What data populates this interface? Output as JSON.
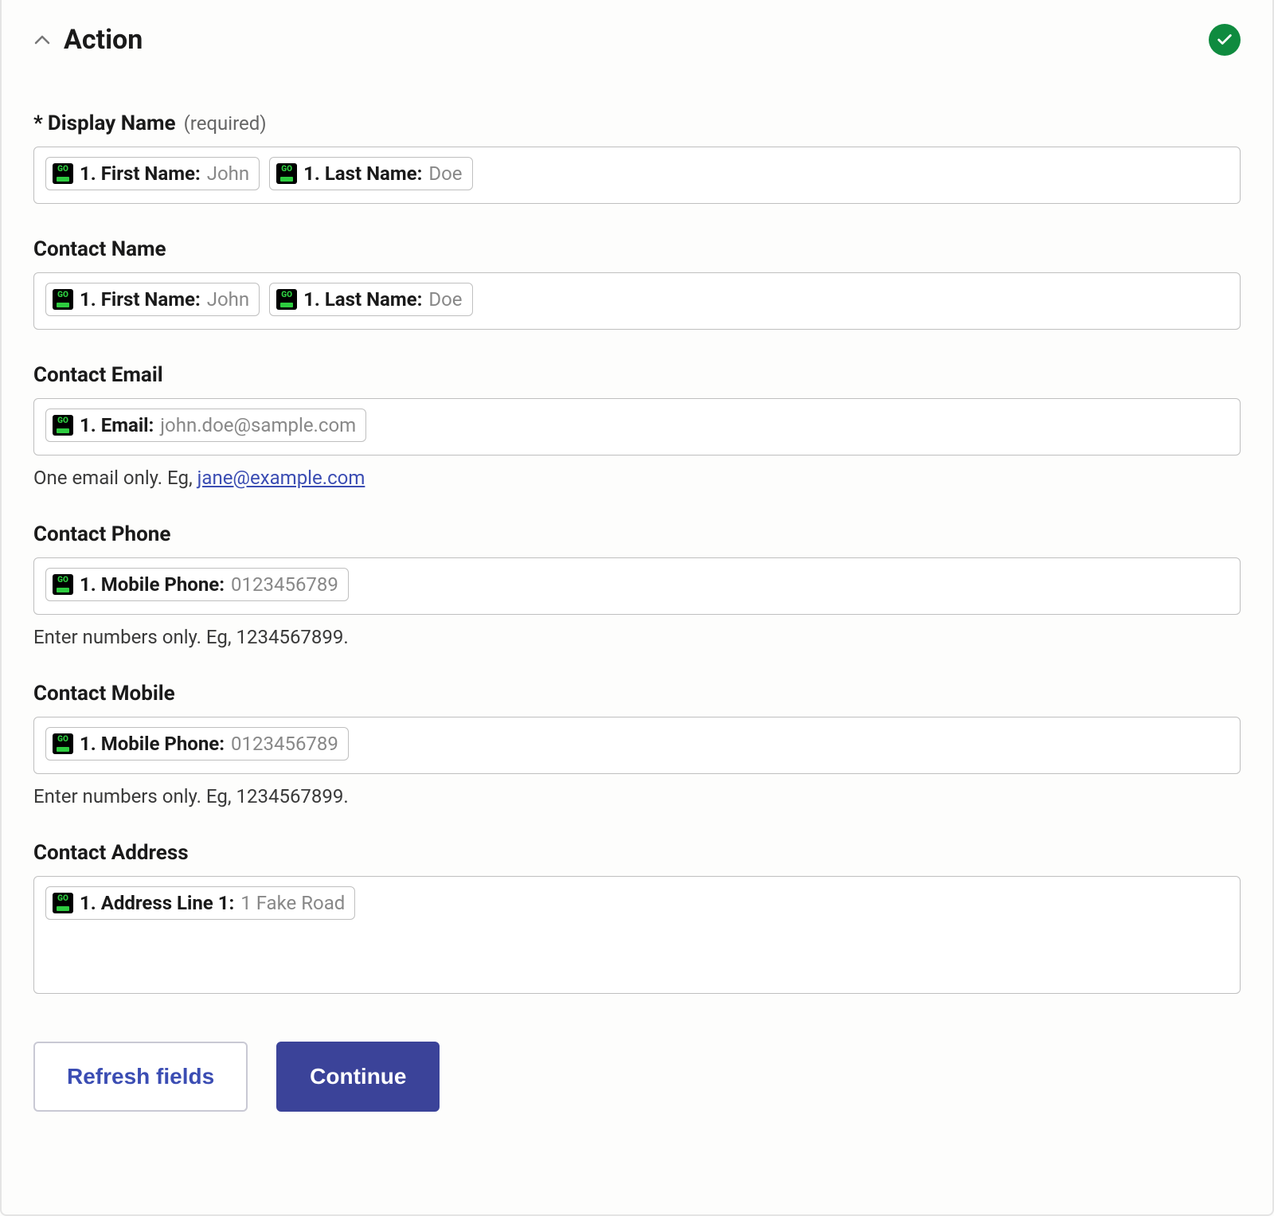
{
  "panel": {
    "title": "Action"
  },
  "fields": {
    "displayName": {
      "label": "Display Name",
      "asterisk": "*",
      "requiredText": "(required)",
      "pills": [
        {
          "label": "1. First Name:",
          "value": "John"
        },
        {
          "label": "1. Last Name:",
          "value": "Doe"
        }
      ]
    },
    "contactName": {
      "label": "Contact Name",
      "pills": [
        {
          "label": "1. First Name:",
          "value": "John"
        },
        {
          "label": "1. Last Name:",
          "value": "Doe"
        }
      ]
    },
    "contactEmail": {
      "label": "Contact Email",
      "pills": [
        {
          "label": "1. Email:",
          "value": "john.doe@sample.com"
        }
      ],
      "helpPrefix": "One email only. Eg, ",
      "helpLink": "jane@example.com"
    },
    "contactPhone": {
      "label": "Contact Phone",
      "pills": [
        {
          "label": "1. Mobile Phone:",
          "value": "0123456789"
        }
      ],
      "help": "Enter numbers only. Eg, 1234567899."
    },
    "contactMobile": {
      "label": "Contact Mobile",
      "pills": [
        {
          "label": "1. Mobile Phone:",
          "value": "0123456789"
        }
      ],
      "help": "Enter numbers only. Eg, 1234567899."
    },
    "contactAddress": {
      "label": "Contact Address",
      "pills": [
        {
          "label": "1. Address Line 1:",
          "value": "1 Fake Road"
        }
      ]
    }
  },
  "buttons": {
    "refresh": "Refresh fields",
    "continue": "Continue"
  }
}
